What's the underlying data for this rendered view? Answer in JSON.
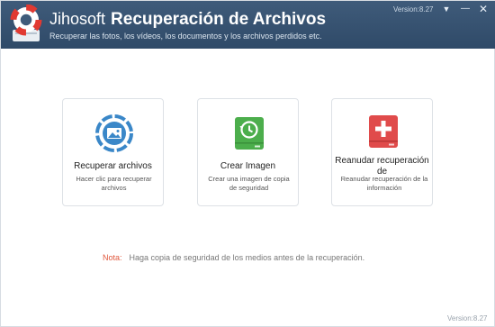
{
  "titlebar": {
    "brand": "Jihosoft",
    "product": "Recuperación de Archivos",
    "subtitle": "Recuperar las fotos, los vídeos, los documentos y los archivos perdidos etc.",
    "version": "Version:8.27",
    "buttons": {
      "menu": "▼",
      "minimize": "—",
      "close": "✕"
    }
  },
  "cards": [
    {
      "title": "Recuperar archivos",
      "desc": "Hacer clic para recuperar archivos",
      "icon": "recover-photo-icon",
      "color": "#3a87c8"
    },
    {
      "title": "Crear Imagen",
      "desc": "Crear una imagen de copia de seguridad",
      "icon": "drive-backup-icon",
      "color": "#4cae4c"
    },
    {
      "title": "Reanudar recuperación de",
      "desc": "Reanudar recuperación de la información",
      "icon": "drive-add-icon",
      "color": "#e04b4b"
    }
  ],
  "note": {
    "label": "Nota:",
    "text": "Haga copia de seguridad de los medios antes de la recuperación."
  },
  "footer": {
    "version": "Version:8.27"
  }
}
